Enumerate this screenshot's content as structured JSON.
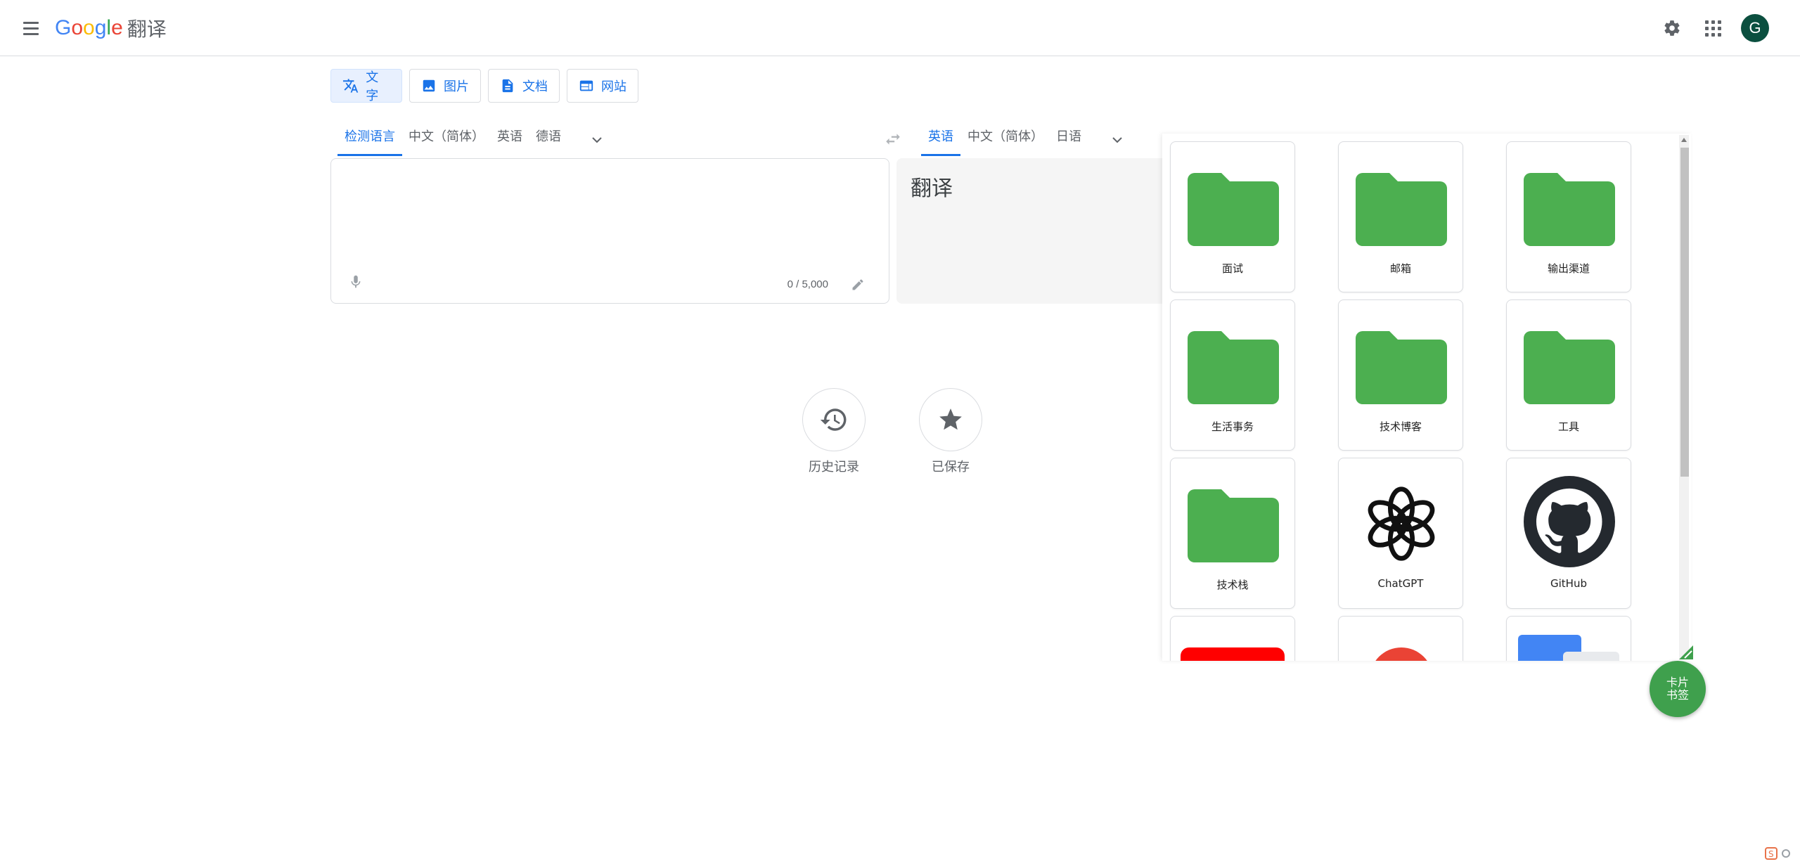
{
  "header": {
    "logo_letters": [
      "G",
      "o",
      "o",
      "g",
      "l",
      "e"
    ],
    "product": "翻译",
    "avatar_letter": "G"
  },
  "modes": [
    {
      "label": "文字",
      "icon": "translate-icon",
      "active": true
    },
    {
      "label": "图片",
      "icon": "image-icon",
      "active": false
    },
    {
      "label": "文档",
      "icon": "document-icon",
      "active": false
    },
    {
      "label": "网站",
      "icon": "website-icon",
      "active": false
    }
  ],
  "source_langs": [
    "检测语言",
    "中文（简体）",
    "英语",
    "德语"
  ],
  "target_langs": [
    "英语",
    "中文（简体）",
    "日语"
  ],
  "source": {
    "value": "",
    "char_count": "0 / 5,000"
  },
  "target": {
    "text": "翻译"
  },
  "actions": {
    "history": "历史记录",
    "saved": "已保存"
  },
  "bookmarks": {
    "cards": [
      {
        "label": "面试",
        "icon": "folder-icon"
      },
      {
        "label": "邮箱",
        "icon": "folder-icon"
      },
      {
        "label": "输出渠道",
        "icon": "folder-icon"
      },
      {
        "label": "生活事务",
        "icon": "folder-icon"
      },
      {
        "label": "技术博客",
        "icon": "folder-icon"
      },
      {
        "label": "工具",
        "icon": "folder-icon"
      },
      {
        "label": "技术栈",
        "icon": "folder-icon"
      },
      {
        "label": "ChatGPT",
        "icon": "openai-icon"
      },
      {
        "label": "GitHub",
        "icon": "github-icon"
      }
    ],
    "fab_line1": "卡片",
    "fab_line2": "书签"
  },
  "colors": {
    "accent": "#1a73e8",
    "folder": "#4caf50",
    "fab": "#3fa04d",
    "avatar": "#0b4f3f"
  }
}
